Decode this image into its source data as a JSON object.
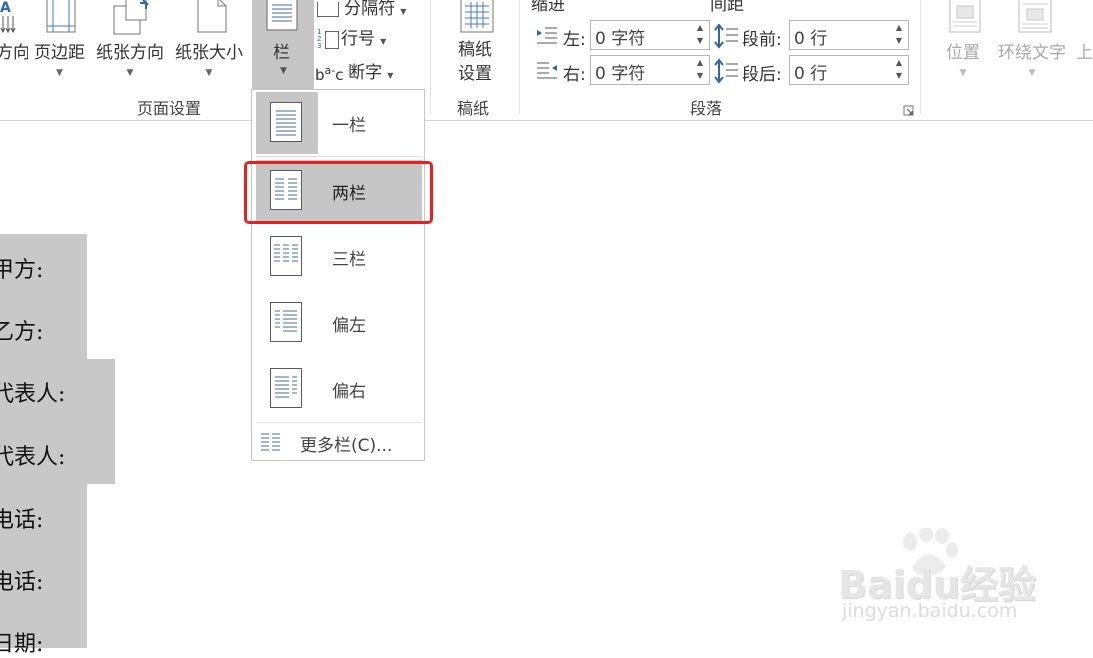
{
  "ribbon": {
    "buttons": {
      "text_direction": "方向",
      "margins": "页边距",
      "orientation": "纸张方向",
      "size": "纸张大小",
      "columns": "栏",
      "breaks": "分隔符",
      "line_numbers": "行号",
      "hyphenation": "断字",
      "draft_paper_line1": "稿纸",
      "draft_paper_line2": "设置",
      "position": "位置",
      "wrap_text": "环绕文字",
      "bring_forward_partial": "上"
    },
    "groups": {
      "page_setup": "页面设置",
      "draft_paper": "稿纸",
      "paragraph": "段落"
    },
    "indent": {
      "header": "缩进",
      "left_label": "左:",
      "left_value": "0 字符",
      "right_label": "右:",
      "right_value": "0 字符"
    },
    "spacing": {
      "header": "间距",
      "before_label": "段前:",
      "before_value": "0 行",
      "after_label": "段后:",
      "after_value": "0 行"
    }
  },
  "columns_menu": {
    "items": [
      {
        "label": "一栏",
        "icon": "one-column-icon"
      },
      {
        "label": "两栏",
        "icon": "two-columns-icon"
      },
      {
        "label": "三栏",
        "icon": "three-columns-icon"
      },
      {
        "label": "偏左",
        "icon": "left-column-icon"
      },
      {
        "label": "偏右",
        "icon": "right-column-icon"
      }
    ],
    "more": "更多栏(C)..."
  },
  "document": {
    "lines": [
      "甲方:",
      "乙方:",
      "代表人:",
      "代表人:",
      "电话:",
      "电话:",
      "日期:"
    ]
  },
  "watermark": {
    "brand": "Baidu经验",
    "url": "jingyan.baidu.com"
  },
  "colors": {
    "menu_selected": "#c6c6c6",
    "highlight_border": "#e52222",
    "doc_gray_box": "#c8c8c8",
    "icon_lines": "#4a6d9c"
  }
}
